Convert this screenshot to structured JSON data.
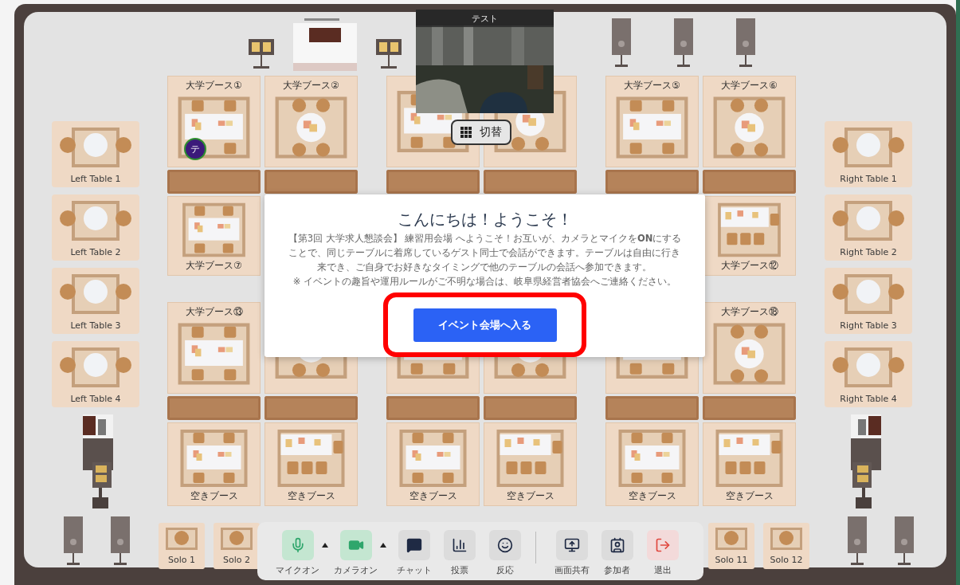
{
  "video_tile": {
    "name": "テスト",
    "kind": "picture"
  },
  "switch_button": {
    "label": "切替"
  },
  "left_tables": [
    {
      "label": "Left Table 1"
    },
    {
      "label": "Left Table 2"
    },
    {
      "label": "Left Table 3"
    },
    {
      "label": "Left Table 4"
    }
  ],
  "right_tables": [
    {
      "label": "Right Table 1"
    },
    {
      "label": "Right Table 2"
    },
    {
      "label": "Right Table 3"
    },
    {
      "label": "Right Table 4"
    }
  ],
  "booth_rows": [
    {
      "booths": [
        {
          "label": "大学ブース①",
          "kind": "rect",
          "avatar": "テ"
        },
        {
          "label": "大学ブース②",
          "kind": "round"
        },
        {
          "kind": "rect"
        },
        {
          "kind": "round"
        },
        {
          "label": "大学ブース⑤",
          "kind": "rect"
        },
        {
          "label": "大学ブース⑥",
          "kind": "round"
        }
      ]
    },
    {
      "booths": [
        {
          "label": "大学ブース⑦",
          "kind": "rect"
        },
        {
          "label": "大学ブース⑫",
          "kind": "counter"
        }
      ]
    },
    {
      "booths": [
        {
          "label": "大学ブース⑬",
          "kind": "rect"
        },
        {
          "kind": "round"
        },
        {
          "kind": "rect"
        },
        {
          "kind": "round"
        },
        {
          "kind": "rect"
        },
        {
          "label": "大学ブース⑱",
          "kind": "round"
        }
      ]
    },
    {
      "booths": [
        {
          "label": "空きブース",
          "kind": "rect"
        },
        {
          "label": "空きブース",
          "kind": "counter"
        },
        {
          "label": "空きブース",
          "kind": "rect"
        },
        {
          "label": "空きブース",
          "kind": "counter"
        },
        {
          "label": "空きブース",
          "kind": "rect"
        },
        {
          "label": "空きブース",
          "kind": "counter"
        }
      ]
    }
  ],
  "solo_tables_left": [
    {
      "label": "Solo 1"
    },
    {
      "label": "Solo 2"
    }
  ],
  "solo_tables_right": [
    {
      "label": "Solo 11"
    },
    {
      "label": "Solo 12"
    }
  ],
  "dialog": {
    "title": "こんにちは！ようこそ！",
    "message": [
      "【第3回 大学求人懇談会】 練習用会場 へようこそ！お互いが、カメラとマイクを**ON**にする",
      "ことで、同じテーブルに着席しているゲスト同士で会話ができます。テーブルは自由に行き",
      "来でき、ご自身でお好きなタイミングで他のテーブルの会話へ参加できます。"
    ],
    "note": "※ イベントの趣旨や運用ルールがご不明な場合は、岐阜県経営者協会へご連絡ください。",
    "button": "イベント会場へ入る"
  },
  "toolbar": {
    "groups": [
      {
        "buttons": [
          {
            "kind": "mic",
            "label": "マイクオン",
            "on": true,
            "caret": true
          },
          {
            "kind": "camera",
            "label": "カメラオン",
            "on": true,
            "caret": true
          },
          {
            "kind": "chat",
            "label": "チャット"
          },
          {
            "kind": "poll",
            "label": "投票"
          },
          {
            "kind": "reaction",
            "label": "反応"
          }
        ]
      },
      {
        "buttons": [
          {
            "kind": "share",
            "label": "画面共有"
          },
          {
            "kind": "participants",
            "label": "参加者"
          },
          {
            "kind": "leave",
            "label": "退出"
          }
        ]
      }
    ]
  }
}
